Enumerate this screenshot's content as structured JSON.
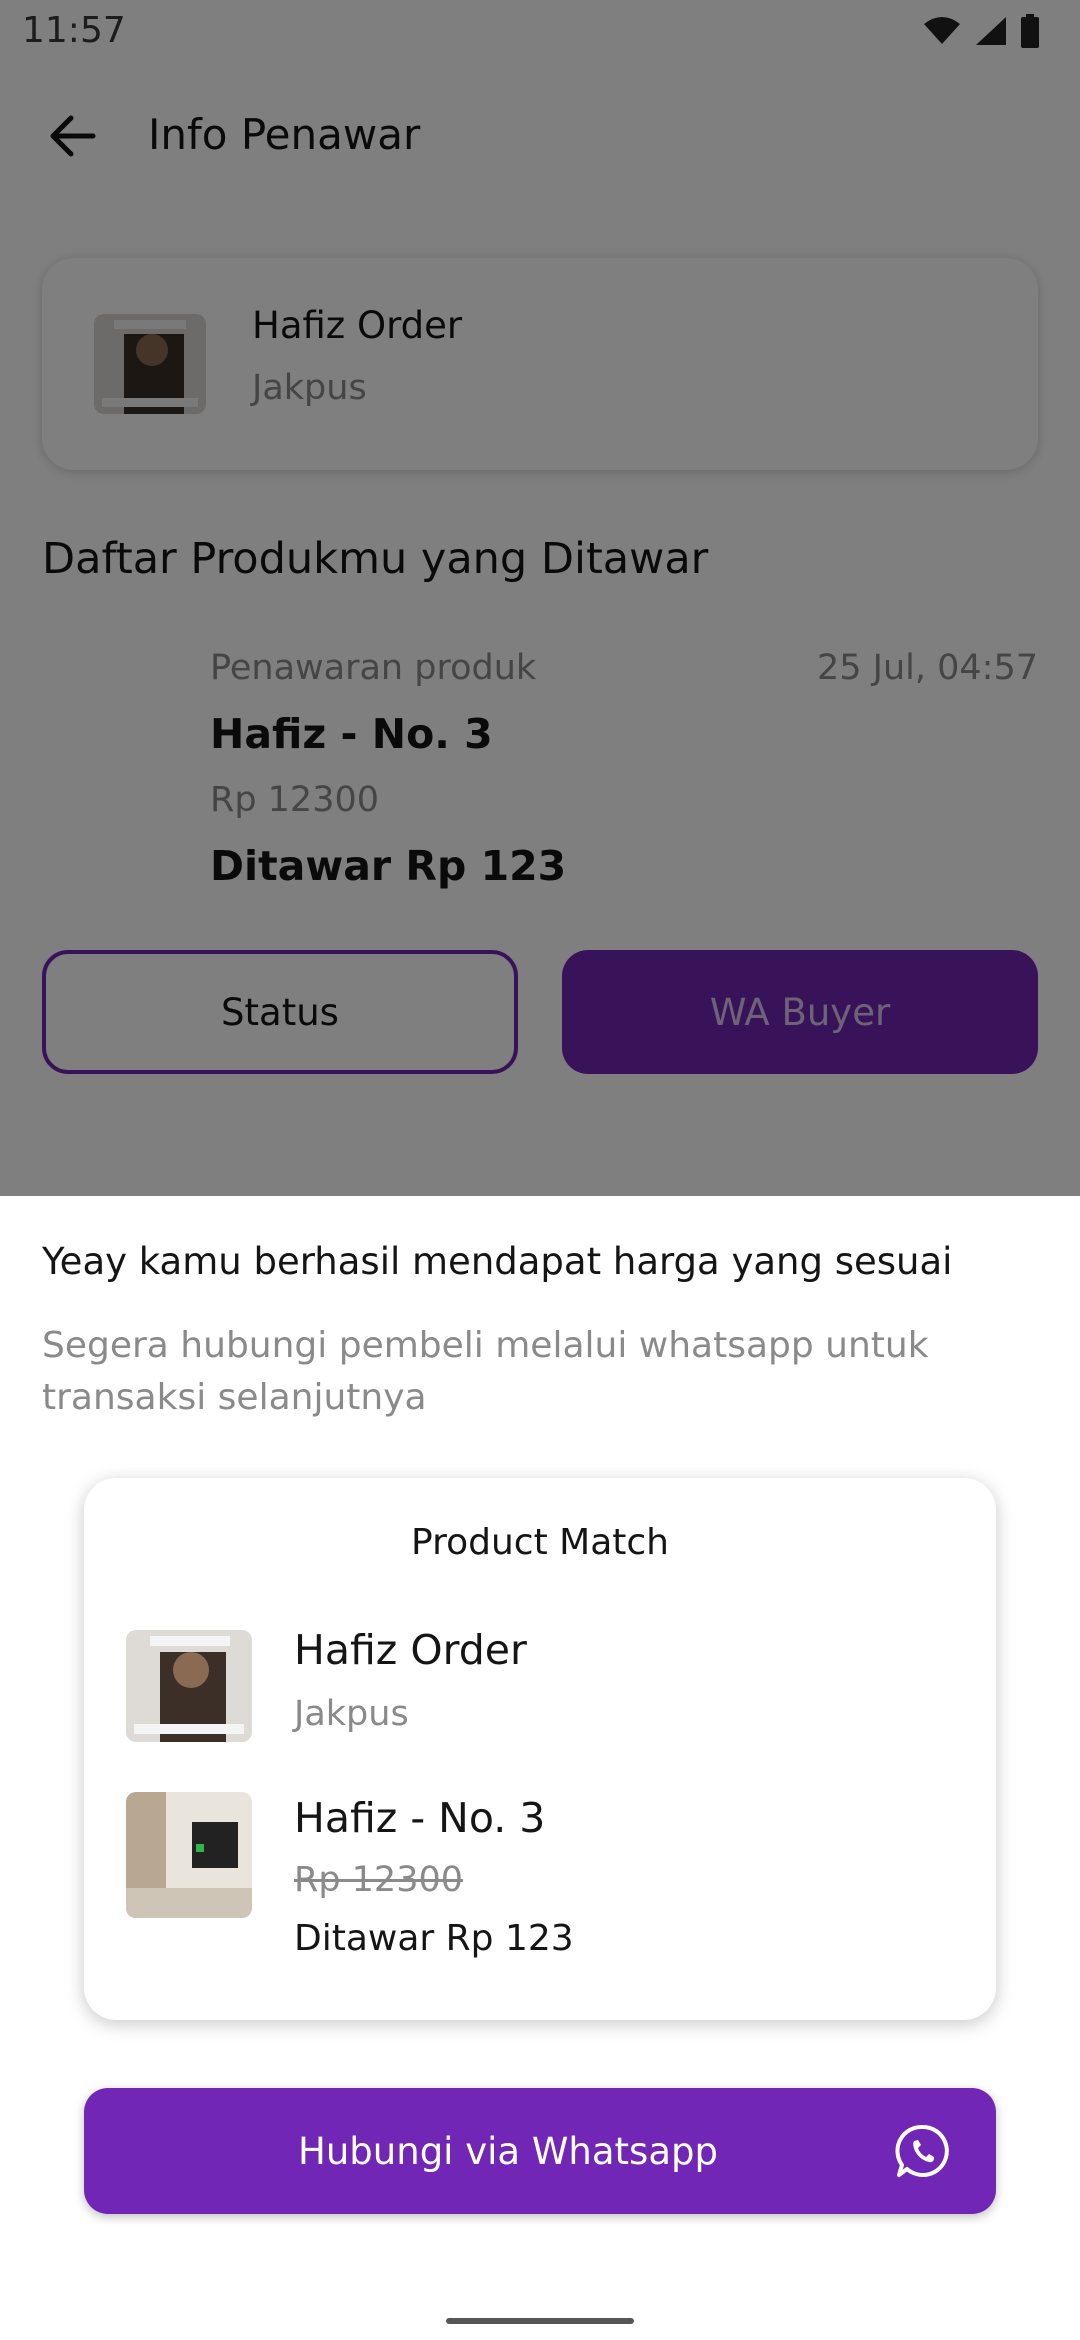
{
  "status_bar": {
    "time": "11:57",
    "icons": [
      "wifi-icon",
      "signal-icon",
      "battery-icon"
    ]
  },
  "appbar": {
    "back_icon": "arrow-left-icon",
    "title": "Info Penawar"
  },
  "buyer_card": {
    "name": "Hafiz Order",
    "city": "Jakpus"
  },
  "section": {
    "title": "Daftar Produkmu yang Ditawar"
  },
  "offer": {
    "label": "Penawaran produk",
    "date": "25 Jul, 04:57",
    "product": "Hafiz - No. 3",
    "price": "Rp 12300",
    "bid": "Ditawar Rp 123"
  },
  "actions": {
    "status_label": "Status",
    "wa_buyer_label": "WA Buyer"
  },
  "sheet": {
    "title": "Yeay kamu berhasil mendapat harga yang sesuai",
    "description": "Segera hubungi pembeli melalui whatsapp untuk transaksi selanjutnya",
    "match": {
      "title": "Product Match",
      "buyer_name": "Hafiz Order",
      "buyer_city": "Jakpus",
      "product_name": "Hafiz - No. 3",
      "old_price": "Rp 12300",
      "bid": "Ditawar Rp 123"
    },
    "whatsapp_button": "Hubungi via Whatsapp",
    "whatsapp_icon": "whatsapp-icon"
  },
  "colors": {
    "primary": "#7126b5",
    "muted_text": "#8a8a8a",
    "text": "#151515"
  }
}
